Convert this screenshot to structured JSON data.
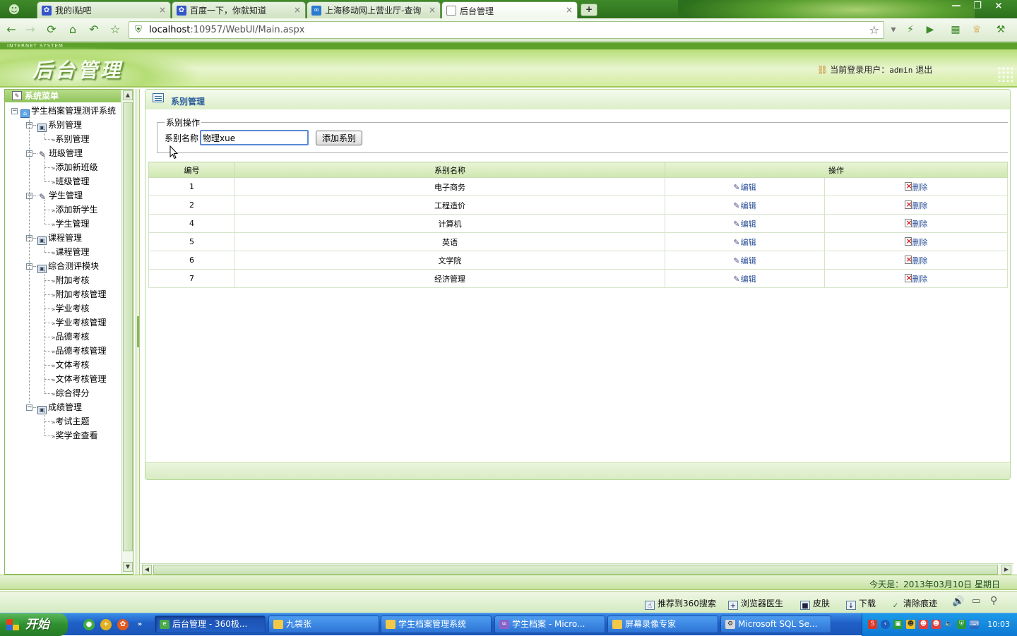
{
  "browser": {
    "tabs": [
      {
        "label": "我的i贴吧",
        "icon": "baidu-paw-icon"
      },
      {
        "label": "百度一下，你就知道",
        "icon": "baidu-paw-icon"
      },
      {
        "label": "上海移动网上营业厅-查询",
        "icon": "china-mobile-icon"
      },
      {
        "label": "后台管理",
        "icon": "page-icon"
      }
    ],
    "url_host": "localhost",
    "url_rest": ":10957/WebUI/Main.aspx"
  },
  "header": {
    "tagline": "INTERNET SYSTEM",
    "logo": "后台管理",
    "user_label": "当前登录用户：",
    "username": "admin",
    "logout": "退出"
  },
  "sidebar": {
    "title": "系统菜单",
    "root": "学生档案管理测评系统",
    "groups": [
      {
        "label": "系别管理",
        "icon": "floppy-icon",
        "items": [
          "系别管理"
        ]
      },
      {
        "label": "班级管理",
        "icon": "pencil-icon",
        "items": [
          "添加新班级",
          "班级管理"
        ]
      },
      {
        "label": "学生管理",
        "icon": "pencil-icon",
        "items": [
          "添加新学生",
          "学生管理"
        ]
      },
      {
        "label": "课程管理",
        "icon": "floppy-icon",
        "items": [
          "课程管理"
        ]
      },
      {
        "label": "综合测评模块",
        "icon": "floppy-icon",
        "items": [
          "附加考核",
          "附加考核管理",
          "学业考核",
          "学业考核管理",
          "品德考核",
          "品德考核管理",
          "文体考核",
          "文体考核管理",
          "综合得分"
        ]
      },
      {
        "label": "成绩管理",
        "icon": "floppy-icon",
        "items": [
          "考试主题",
          "奖学金查看"
        ]
      }
    ]
  },
  "main": {
    "panel_title": "系别管理",
    "fieldset_legend": "系别操作",
    "name_label": "系别名称",
    "name_value": "物理xue",
    "add_button": "添加系别",
    "table": {
      "headers": [
        "编号",
        "系别名称",
        "操作"
      ],
      "edit_label": "编辑",
      "delete_label": "删除",
      "rows": [
        {
          "id": "1",
          "name": "电子商务"
        },
        {
          "id": "2",
          "name": "工程造价"
        },
        {
          "id": "4",
          "name": "计算机"
        },
        {
          "id": "5",
          "name": "英语"
        },
        {
          "id": "6",
          "name": "文学院"
        },
        {
          "id": "7",
          "name": "经济管理"
        }
      ]
    }
  },
  "footer": {
    "date_text": "今天是：2013年03月10日  星期日"
  },
  "statusbar": {
    "items": [
      "推荐到360搜索",
      "浏览器医生",
      "皮肤",
      "下载",
      "清除痕迹"
    ]
  },
  "taskbar": {
    "start": "开始",
    "tasks": [
      "后台管理 - 360极...",
      "九袋张",
      "学生档案管理系统",
      "学生档案 - Micro...",
      "屏幕录像专家",
      "Microsoft SQL Se..."
    ],
    "clock": "10:03"
  },
  "colors": {
    "accent_green": "#8fc45a",
    "panel_title_blue": "#2a5d9b",
    "taskbar_blue": "#1f5fc7"
  }
}
